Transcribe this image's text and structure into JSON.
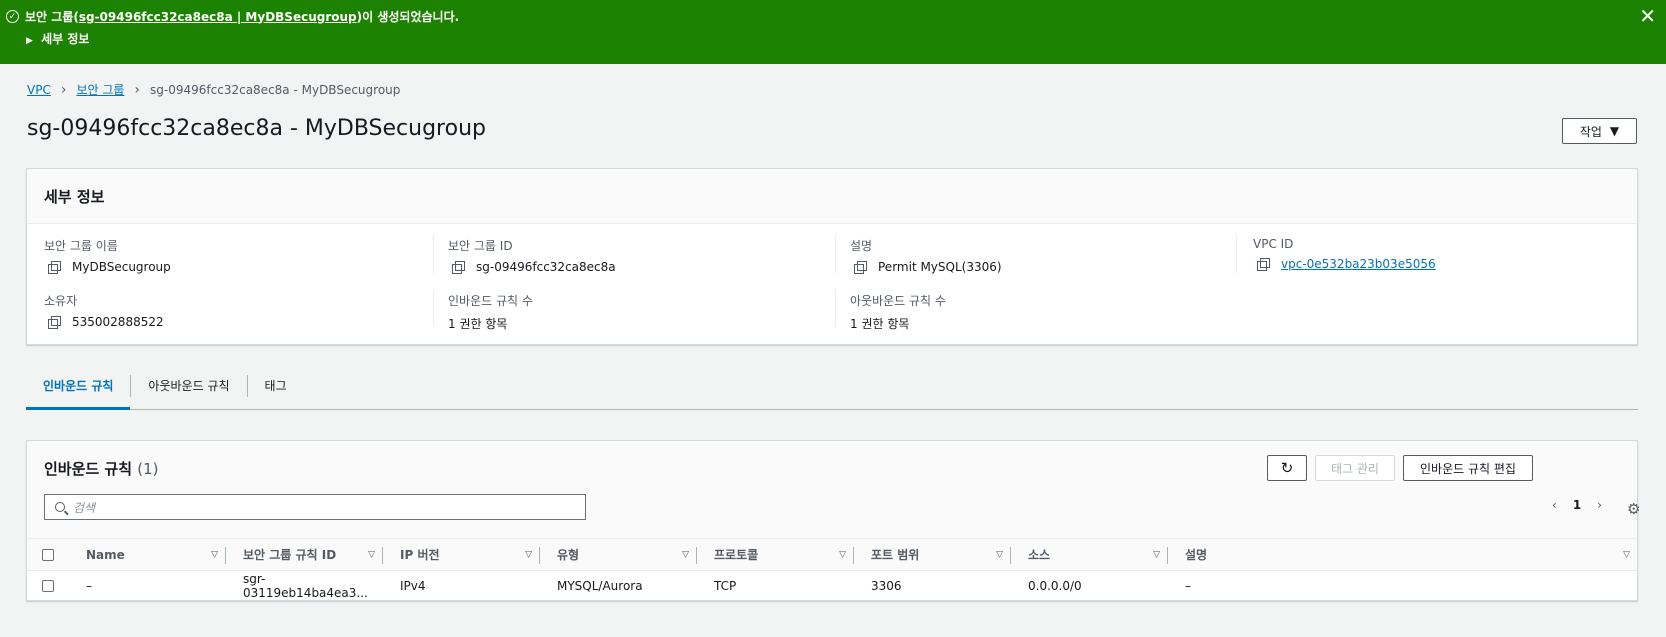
{
  "flash": {
    "prefix": "보안 그룹(",
    "link_text": "sg-09496fcc32ca8ec8a | MyDBSecugroup",
    "suffix": ")이 생성되었습니다.",
    "details_label": "세부 정보",
    "close_icon": "close-icon",
    "color": "#1d8102"
  },
  "breadcrumb": {
    "items": [
      "VPC",
      "보안 그룹",
      "sg-09496fcc32ca8ec8a - MyDBSecugroup"
    ]
  },
  "page": {
    "title": "sg-09496fcc32ca8ec8a - MyDBSecugroup",
    "actions_label": "작업"
  },
  "details": {
    "header": "세부 정보",
    "fields": [
      {
        "label": "보안 그룹 이름",
        "value": "MyDBSecugroup"
      },
      {
        "label": "보안 그룹 ID",
        "value": "sg-09496fcc32ca8ec8a"
      },
      {
        "label": "설명",
        "value": "Permit MySQL(3306)"
      },
      {
        "label": "VPC ID",
        "value": "vpc-0e532ba23b03e5056"
      },
      {
        "label": "소유자",
        "value": "535002888522"
      },
      {
        "label": "인바운드 규칙 수",
        "value": "1 권한 항목"
      },
      {
        "label": "아웃바운드 규칙 수",
        "value": "1 권한 항목"
      }
    ]
  },
  "tabs": [
    "인바운드 규칙",
    "아웃바운드 규칙",
    "태그"
  ],
  "inbound": {
    "title": "인바운드 규칙",
    "count": "(1)",
    "manage_tags_label": "태그 관리",
    "edit_label": "인바운드 규칙 편집",
    "search_placeholder": "검색",
    "page_number": "1",
    "columns": [
      "Name",
      "보안 그룹 규칙 ID",
      "IP 버전",
      "유형",
      "프로토콜",
      "포트 범위",
      "소스",
      "설명"
    ],
    "rows": [
      [
        "–",
        "sgr-03119eb14ba4ea3...",
        "IPv4",
        "MYSQL/Aurora",
        "TCP",
        "3306",
        "0.0.0.0/0",
        "–"
      ]
    ]
  },
  "colors": {
    "accent": "#0073bb",
    "success": "#1d8102"
  }
}
